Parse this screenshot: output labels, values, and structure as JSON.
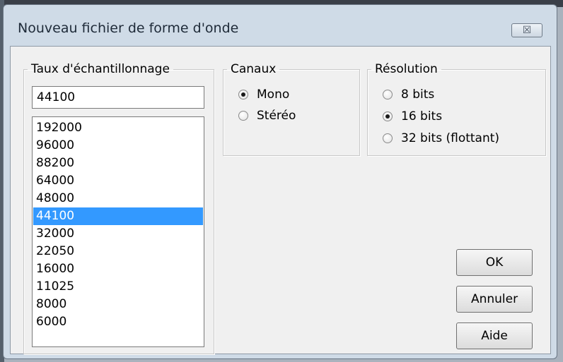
{
  "window": {
    "title": "Nouveau fichier de forme d'onde",
    "close_glyph": "☒"
  },
  "rate_group": {
    "legend": "Taux d'échantillonnage",
    "input_value": "44100",
    "items": [
      "192000",
      "96000",
      "88200",
      "64000",
      "48000",
      "44100",
      "32000",
      "22050",
      "16000",
      "11025",
      "8000",
      "6000"
    ],
    "selected": "44100"
  },
  "channels_group": {
    "legend": "Canaux",
    "options": [
      {
        "label": "Mono",
        "checked": true
      },
      {
        "label": "Stéréo",
        "checked": false
      }
    ]
  },
  "resolution_group": {
    "legend": "Résolution",
    "options": [
      {
        "label": "8 bits",
        "checked": false
      },
      {
        "label": "16 bits",
        "checked": true
      },
      {
        "label": "32 bits (flottant)",
        "checked": false
      }
    ]
  },
  "buttons": {
    "ok": "OK",
    "cancel": "Annuler",
    "help": "Aide"
  },
  "colors": {
    "selection": "#3399ff",
    "dialog_face": "#f0f0f0",
    "frame": "#cfdbe7"
  }
}
